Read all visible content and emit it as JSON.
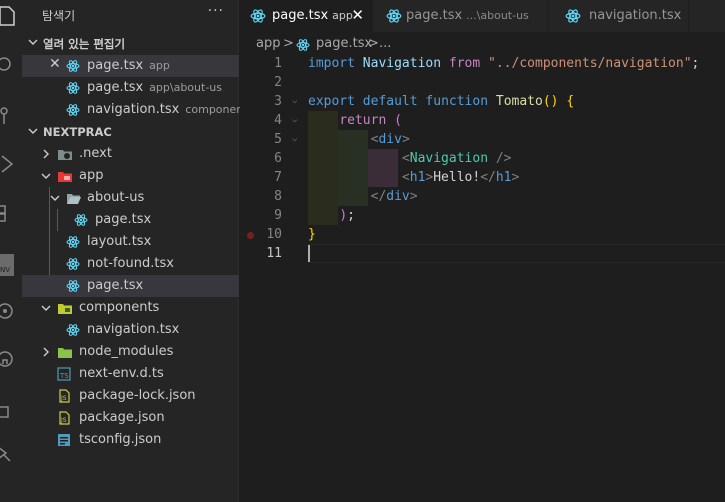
{
  "activity_bar": {
    "icons": [
      "files-icon",
      "search-icon",
      "source-control-icon",
      "run-debug-icon",
      "extensions-icon",
      "nv-icon",
      "remote-icon",
      "github-icon",
      "testing-icon",
      "share-icon"
    ]
  },
  "sidebar": {
    "title": "탐색기",
    "more": "···",
    "open_editors": {
      "header": "열려 있는 편집기",
      "items": [
        {
          "name": "page.tsx",
          "desc": "app"
        },
        {
          "name": "page.tsx",
          "desc": "app\\about-us"
        },
        {
          "name": "navigation.tsx",
          "desc": "components"
        }
      ]
    },
    "project": {
      "header": "NEXTPRAC",
      "tree": [
        {
          "label": ".next"
        },
        {
          "label": "app"
        },
        {
          "label": "about-us"
        },
        {
          "label": "page.tsx"
        },
        {
          "label": "layout.tsx"
        },
        {
          "label": "not-found.tsx"
        },
        {
          "label": "page.tsx"
        },
        {
          "label": "components"
        },
        {
          "label": "navigation.tsx"
        },
        {
          "label": "node_modules"
        },
        {
          "label": "next-env.d.ts"
        },
        {
          "label": "package-lock.json"
        },
        {
          "label": "package.json"
        },
        {
          "label": "tsconfig.json"
        }
      ]
    }
  },
  "tabs": [
    {
      "name": "page.tsx",
      "desc": "app",
      "active": true,
      "close": "✕"
    },
    {
      "name": "page.tsx",
      "desc": "...\\about-us",
      "active": false
    },
    {
      "name": "navigation.tsx",
      "desc": "",
      "active": false
    }
  ],
  "breadcrumb": {
    "folder": "app",
    "sep1": ">",
    "file": "page.tsx",
    "sep2": ">",
    "more": "..."
  },
  "code": {
    "line_numbers": [
      "1",
      "2",
      "3",
      "4",
      "5",
      "6",
      "7",
      "8",
      "9",
      "10",
      "11"
    ],
    "current_line": "11",
    "lines": [
      {
        "t": [
          [
            "kw",
            "import "
          ],
          [
            "id",
            "Navigation "
          ],
          [
            "ctl",
            "from "
          ],
          [
            "str",
            "\"../components/navigation\""
          ],
          [
            "txt",
            ";"
          ]
        ]
      },
      {
        "t": []
      },
      {
        "t": [
          [
            "kw",
            "export "
          ],
          [
            "kw",
            "default "
          ],
          [
            "kw",
            "function "
          ],
          [
            "fn",
            "Tomato"
          ],
          [
            "b1",
            "() {"
          ]
        ]
      },
      {
        "t": [
          [
            "txt",
            "    "
          ],
          [
            "ctl",
            "return "
          ],
          [
            "b2",
            "("
          ]
        ]
      },
      {
        "t": [
          [
            "txt",
            "        "
          ],
          [
            "pg",
            "<"
          ],
          [
            "tag",
            "div"
          ],
          [
            "pg",
            ">"
          ]
        ]
      },
      {
        "t": [
          [
            "txt",
            "            "
          ],
          [
            "pg",
            "<"
          ],
          [
            "cmp",
            "Navigation"
          ],
          [
            "pg",
            " />"
          ]
        ]
      },
      {
        "t": [
          [
            "txt",
            "            "
          ],
          [
            "pg",
            "<"
          ],
          [
            "tag",
            "h1"
          ],
          [
            "pg",
            ">"
          ],
          [
            "txt",
            "Hello!"
          ],
          [
            "pg",
            "</"
          ],
          [
            "tag",
            "h1"
          ],
          [
            "pg",
            ">"
          ]
        ]
      },
      {
        "t": [
          [
            "txt",
            "        "
          ],
          [
            "pg",
            "</"
          ],
          [
            "tag",
            "div"
          ],
          [
            "pg",
            ">"
          ]
        ]
      },
      {
        "t": [
          [
            "txt",
            "    "
          ],
          [
            "b2",
            ")"
          ],
          [
            "txt",
            ";"
          ]
        ]
      },
      {
        "t": [
          [
            "b1",
            "}"
          ]
        ]
      },
      {
        "t": []
      }
    ]
  },
  "colors": {
    "react_icon": "#61dafb",
    "ts_icon": "#519aba",
    "json_icon": "#cbcb41",
    "selected_row": "#37373d",
    "breakpoint": "#7a1f1f"
  }
}
